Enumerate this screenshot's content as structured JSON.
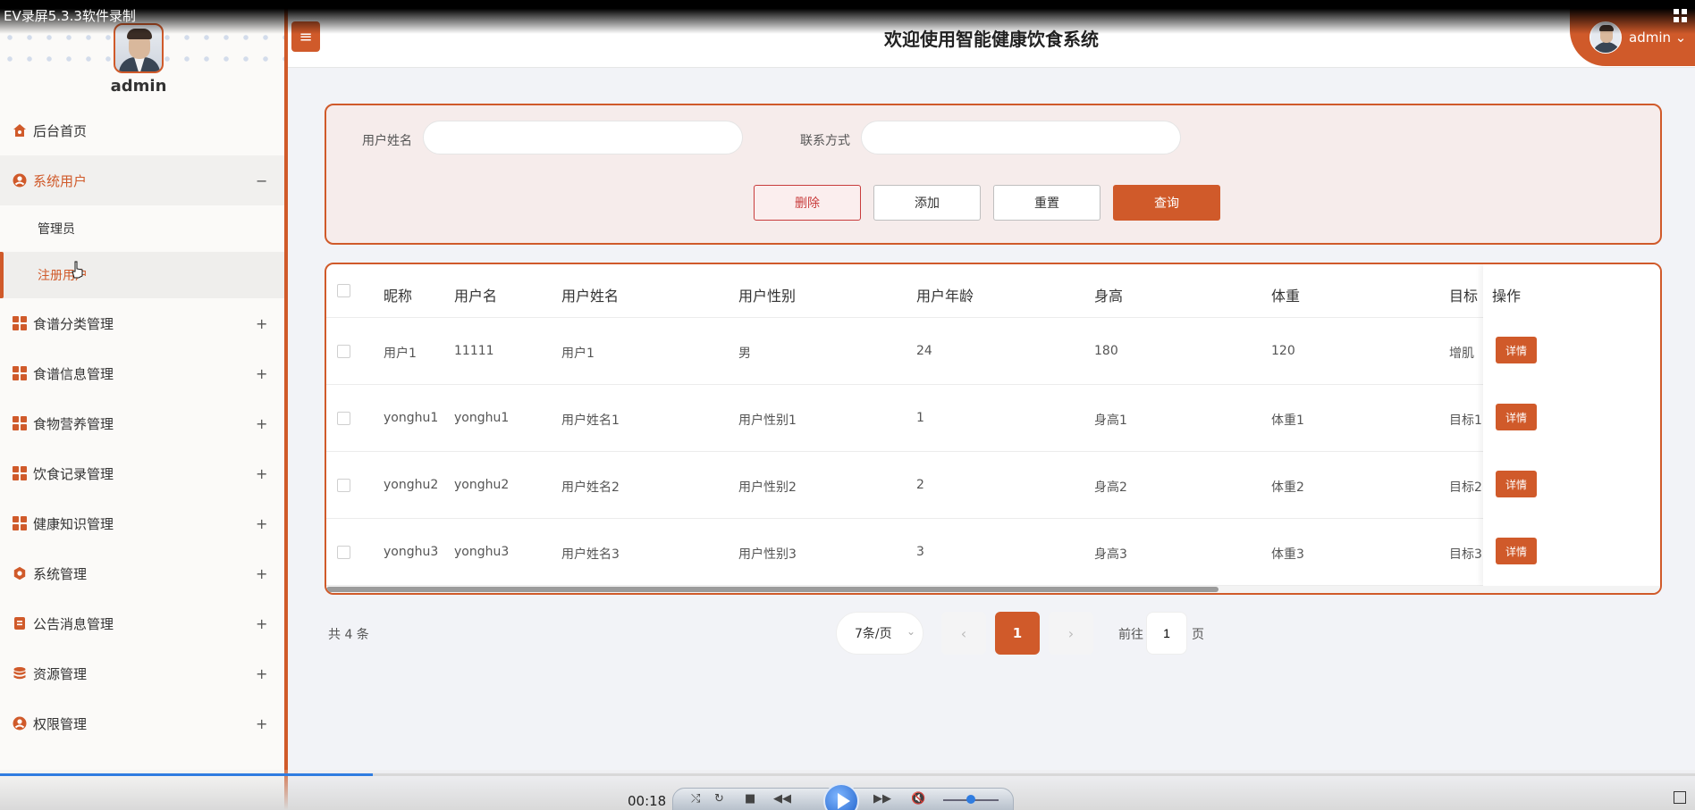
{
  "recorder": {
    "title": "EV录屏5.3.3软件录制"
  },
  "sidebar": {
    "username": "admin",
    "items": [
      {
        "label": "后台首页",
        "icon": "home-icon",
        "toggle": ""
      },
      {
        "label": "系统用户",
        "icon": "user-circle-icon",
        "toggle": "−"
      },
      {
        "label": "食谱分类管理",
        "icon": "grid-icon",
        "toggle": "+"
      },
      {
        "label": "食谱信息管理",
        "icon": "grid-icon",
        "toggle": "+"
      },
      {
        "label": "食物营养管理",
        "icon": "grid-icon",
        "toggle": "+"
      },
      {
        "label": "饮食记录管理",
        "icon": "grid-icon",
        "toggle": "+"
      },
      {
        "label": "健康知识管理",
        "icon": "grid-icon",
        "toggle": "+"
      },
      {
        "label": "系统管理",
        "icon": "gear-icon",
        "toggle": "+"
      },
      {
        "label": "公告消息管理",
        "icon": "document-icon",
        "toggle": "+"
      },
      {
        "label": "资源管理",
        "icon": "database-icon",
        "toggle": "+"
      },
      {
        "label": "权限管理",
        "icon": "user-circle-icon",
        "toggle": "+"
      }
    ],
    "sub_items": [
      {
        "label": "管理员"
      },
      {
        "label": "注册用户"
      }
    ]
  },
  "header": {
    "menu_toggle": "≡",
    "title": "欢迎使用智能健康饮食系统",
    "user": "admin ⌄"
  },
  "search": {
    "name_label": "用户姓名",
    "name_value": "",
    "contact_label": "联系方式",
    "contact_value": "",
    "delete_label": "删除",
    "add_label": "添加",
    "reset_label": "重置",
    "query_label": "查询"
  },
  "table": {
    "headers": [
      "昵称",
      "用户名",
      "用户姓名",
      "用户性别",
      "用户年龄",
      "身高",
      "体重",
      "目标",
      "操作"
    ],
    "rows": [
      {
        "nickname": "用户1",
        "username": "11111",
        "realname": "用户1",
        "gender": "男",
        "age": "24",
        "height": "180",
        "weight": "120",
        "goal": "增肌",
        "action": "详情"
      },
      {
        "nickname": "yonghu1",
        "username": "yonghu1",
        "realname": "用户姓名1",
        "gender": "用户性别1",
        "age": "1",
        "height": "身高1",
        "weight": "体重1",
        "goal": "目标1",
        "action": "详情"
      },
      {
        "nickname": "yonghu2",
        "username": "yonghu2",
        "realname": "用户姓名2",
        "gender": "用户性别2",
        "age": "2",
        "height": "身高2",
        "weight": "体重2",
        "goal": "目标2",
        "action": "详情"
      },
      {
        "nickname": "yonghu3",
        "username": "yonghu3",
        "realname": "用户姓名3",
        "gender": "用户性别3",
        "age": "3",
        "height": "身高3",
        "weight": "体重3",
        "goal": "目标3",
        "action": "详情"
      }
    ]
  },
  "pagination": {
    "total": "共 4 条",
    "page_size": "7条/页",
    "prev": "‹",
    "current": "1",
    "next": "›",
    "goto_label": "前往",
    "goto_value": "1",
    "page_suffix": "页"
  },
  "player": {
    "time": "00:18",
    "progress": 0.22
  },
  "colors": {
    "accent": "#d05a2a",
    "danger": "#c83c3c",
    "panel_bg": "#f6eceb"
  }
}
